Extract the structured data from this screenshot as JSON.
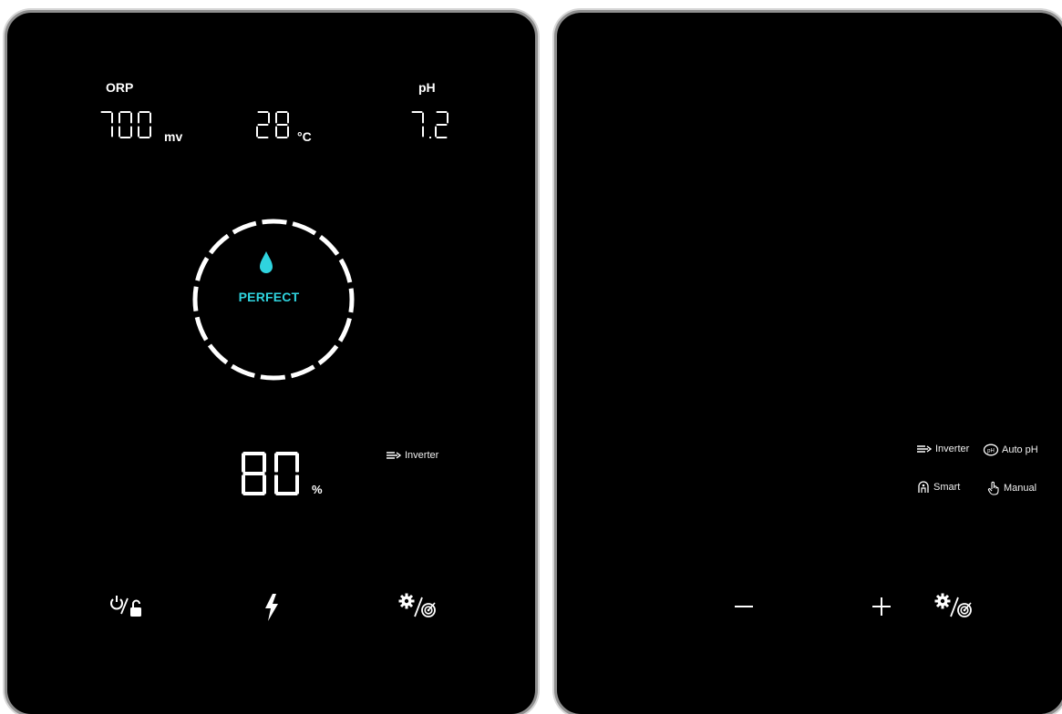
{
  "left_panel": {
    "orp": {
      "label": "ORP",
      "value": "700",
      "unit": "mv"
    },
    "temperature": {
      "value": "28",
      "unit": "°C"
    },
    "ph": {
      "label": "pH",
      "value": "7.2"
    },
    "status": {
      "text": "PERFECT",
      "icon": "water-drop-icon",
      "color": "#2fd4df"
    },
    "level": {
      "value": "80",
      "unit": "%"
    },
    "mode_indicator": {
      "label": "Inverter",
      "icon": "inverter-icon"
    },
    "buttons": [
      {
        "name": "power-lock",
        "icon": "power-lock-icon"
      },
      {
        "name": "boost",
        "icon": "lightning-bolt-icon"
      },
      {
        "name": "settings-target",
        "icon": "settings-target-icon"
      }
    ]
  },
  "right_panel": {
    "indicators": [
      {
        "label": "Inverter",
        "icon": "inverter-icon"
      },
      {
        "label": "Auto pH",
        "icon": "auto-ph-icon"
      },
      {
        "label": "Smart",
        "icon": "smart-icon"
      },
      {
        "label": "Manual",
        "icon": "manual-hand-icon"
      }
    ],
    "buttons": [
      {
        "name": "minus",
        "icon": "minus-icon"
      },
      {
        "name": "plus",
        "icon": "plus-icon"
      },
      {
        "name": "settings-target",
        "icon": "settings-target-icon"
      }
    ]
  },
  "colors": {
    "panel": "#000000",
    "accent": "#2fd4df",
    "foreground": "#ffffff",
    "frame": "#8f8f8f"
  }
}
